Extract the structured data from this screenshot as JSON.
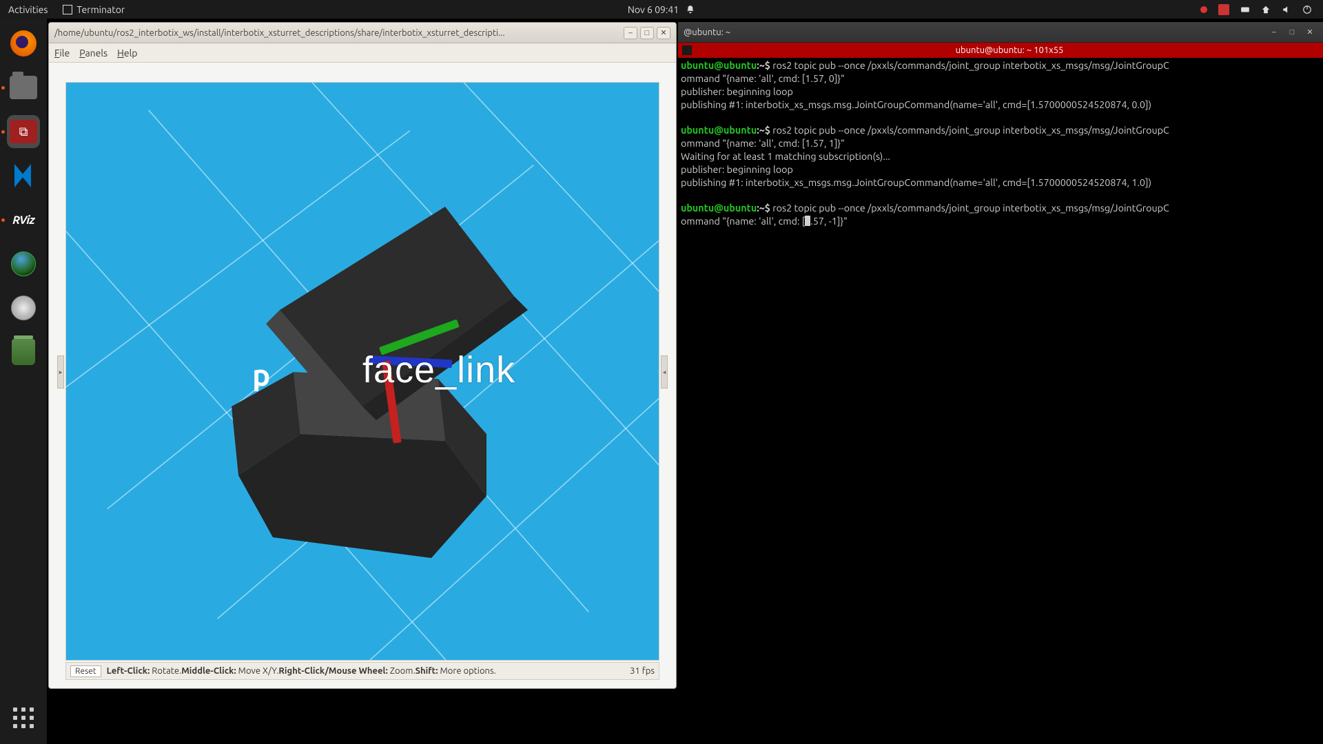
{
  "panel": {
    "activities": "Activities",
    "app_name": "Terminator",
    "datetime": "Nov 6  09:41"
  },
  "dock": {
    "items": [
      {
        "name": "firefox",
        "running": false
      },
      {
        "name": "files",
        "running": true
      },
      {
        "name": "terminator",
        "running": true,
        "active": true
      },
      {
        "name": "vscode",
        "running": false
      },
      {
        "name": "rviz",
        "running": true
      },
      {
        "name": "globe",
        "running": false
      },
      {
        "name": "disc",
        "running": false
      },
      {
        "name": "trash",
        "running": false
      }
    ]
  },
  "rviz": {
    "title": "/home/ubuntu/ros2_interbotix_ws/install/interbotix_xsturret_descriptions/share/interbotix_xsturret_descripti...",
    "menu": {
      "file": "File",
      "panels": "Panels",
      "help": "Help"
    },
    "labels": {
      "face": "face_link",
      "p": "p"
    },
    "toolbar": {
      "reset": "Reset",
      "left_b": "Left-Click:",
      "left": " Rotate. ",
      "mid_b": "Middle-Click:",
      "mid": " Move X/Y. ",
      "right_b": "Right-Click/Mouse Wheel:",
      "right": " Zoom. ",
      "shift_b": "Shift:",
      "shift": " More options.",
      "fps": "31 fps"
    }
  },
  "term": {
    "win_title": "@ubuntu: ~",
    "tab_title": "ubuntu@ubuntu: ~ 101x55",
    "prompt_user": "ubuntu@ubuntu",
    "prompt_path": ":~$ ",
    "cmd1_a": "ros2 topic pub --once /pxxls/commands/joint_group interbotix_xs_msgs/msg/JointGroupC",
    "cmd1_b": "ommand \"{name: 'all', cmd: [1.57, 0]}\"",
    "out1a": "publisher: beginning loop",
    "out1b": "publishing #1: interbotix_xs_msgs.msg.JointGroupCommand(name='all', cmd=[1.5700000524520874, 0.0])",
    "cmd2_a": "ros2 topic pub --once /pxxls/commands/joint_group interbotix_xs_msgs/msg/JointGroupC",
    "cmd2_b": "ommand \"{name: 'all', cmd: [1.57, 1]}\"",
    "out2a": "Waiting for at least 1 matching subscription(s)...",
    "out2b": "publisher: beginning loop",
    "out2c": "publishing #1: interbotix_xs_msgs.msg.JointGroupCommand(name='all', cmd=[1.5700000524520874, 1.0])",
    "cmd3_a": "ros2 topic pub --once /pxxls/commands/joint_group interbotix_xs_msgs/msg/JointGroupC",
    "cmd3_b": "ommand \"{name: 'all', cmd: [",
    "cmd3_c": ".57, -1]}\""
  }
}
